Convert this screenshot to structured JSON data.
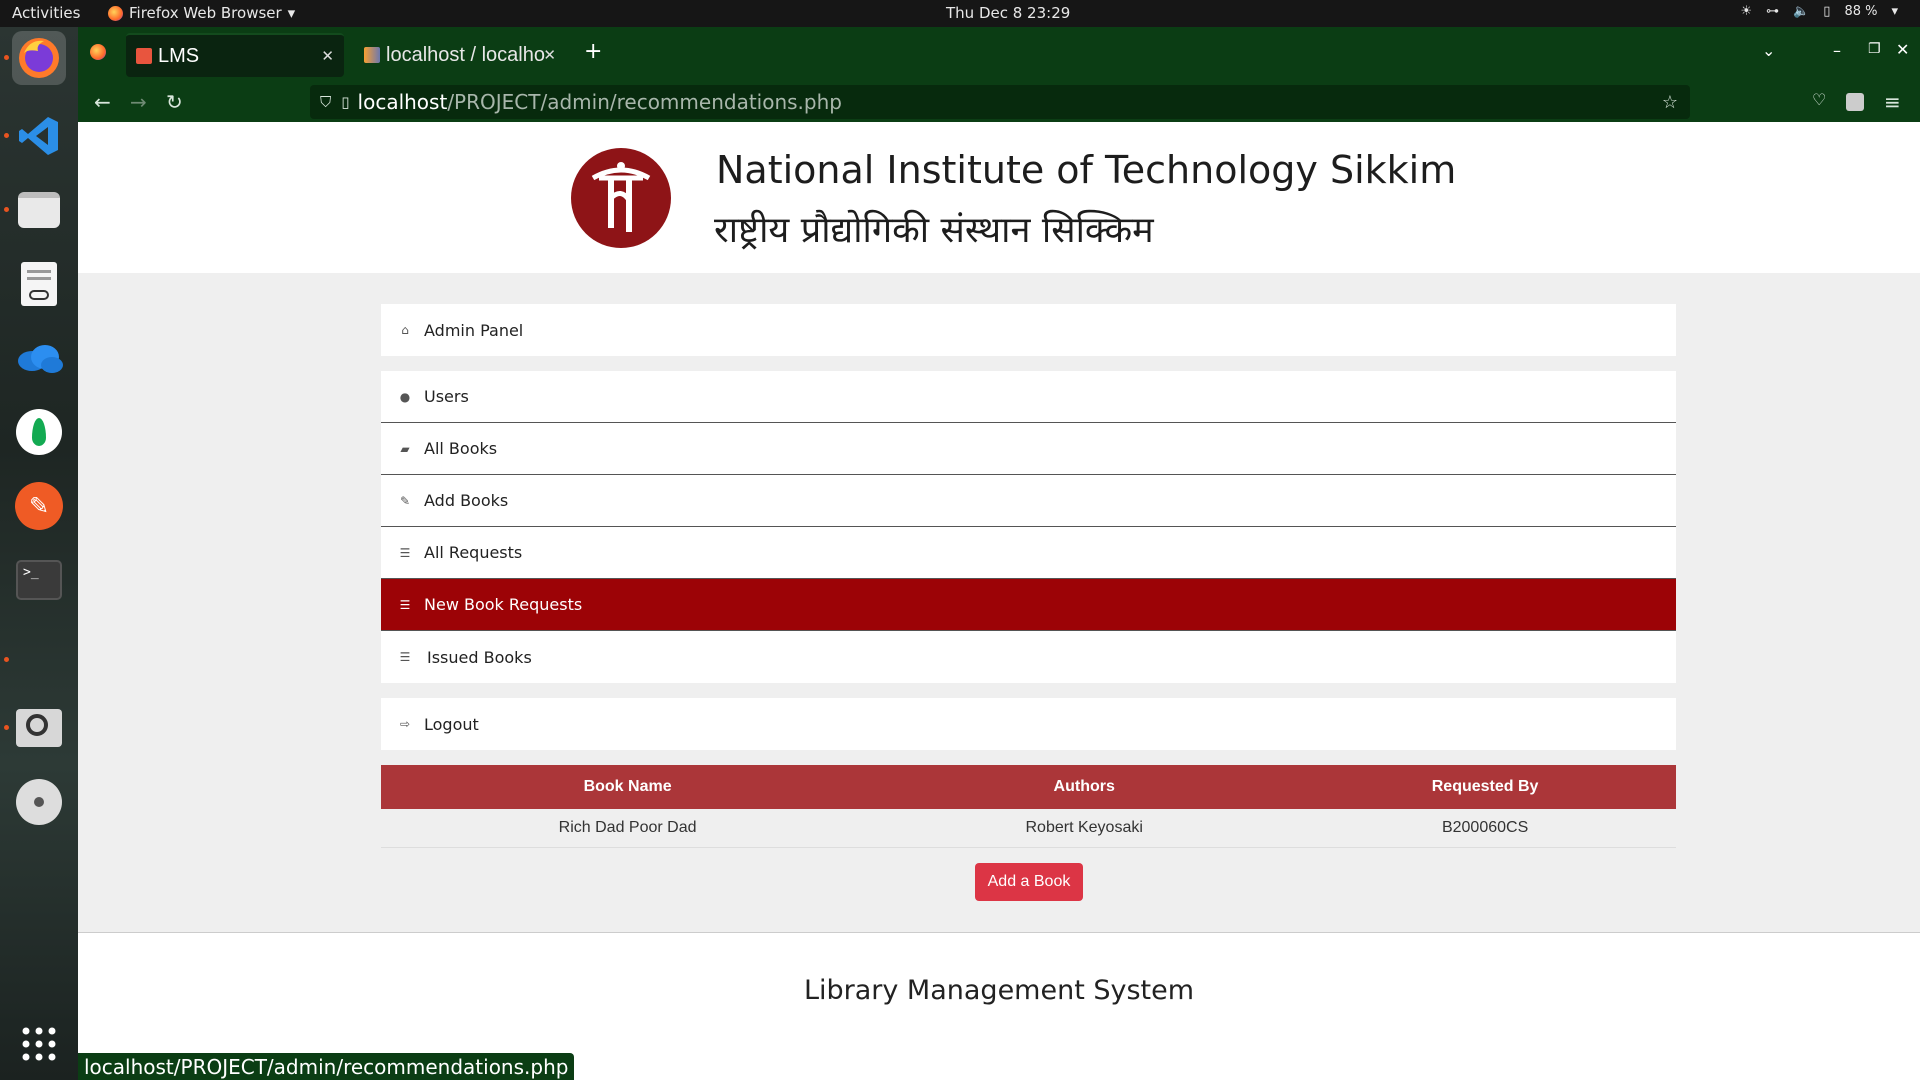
{
  "topbar": {
    "activities": "Activities",
    "app_name": "Firefox Web Browser",
    "clock": "Thu Dec 8  23:29",
    "battery": "88 %"
  },
  "dock": {
    "apps": [
      "firefox-icon",
      "vscode-icon",
      "files-icon",
      "document-viewer-icon",
      "onedrive-icon",
      "mongodb-compass-icon",
      "postman-icon",
      "terminal-icon",
      "image-viewer-icon",
      "disc-icon",
      "app-grid-icon"
    ]
  },
  "browser": {
    "tabs": [
      {
        "label": "LMS",
        "active": true
      },
      {
        "label": "localhost / localho",
        "active": false
      }
    ],
    "url_host": "localhost",
    "url_path": "/PROJECT/admin/recommendations.php"
  },
  "header": {
    "title_en": "National Institute of Technology Sikkim",
    "title_hi": "राष्ट्रीय प्रौद्योगिकी संस्थान सिक्किम"
  },
  "menu": {
    "admin_panel": "Admin Panel",
    "users": "Users",
    "all_books": "All Books",
    "add_books": "Add Books",
    "all_requests": "All Requests",
    "new_book_requests": "New Book Requests",
    "issued_books": "Issued Books",
    "logout": "Logout"
  },
  "table": {
    "headers": [
      "Book Name",
      "Authors",
      "Requested By"
    ],
    "rows": [
      [
        "Rich Dad Poor Dad",
        "Robert Keyosaki",
        "B200060CS"
      ]
    ]
  },
  "add_button": "Add a Book",
  "footer": {
    "title": "Library Management System"
  },
  "status_url": "localhost/PROJECT/admin/recommendations.php",
  "colors": {
    "accent": "#9c0306",
    "table_header": "#ab3639",
    "button": "#dc3545",
    "browser_chrome": "#0b3d14"
  }
}
